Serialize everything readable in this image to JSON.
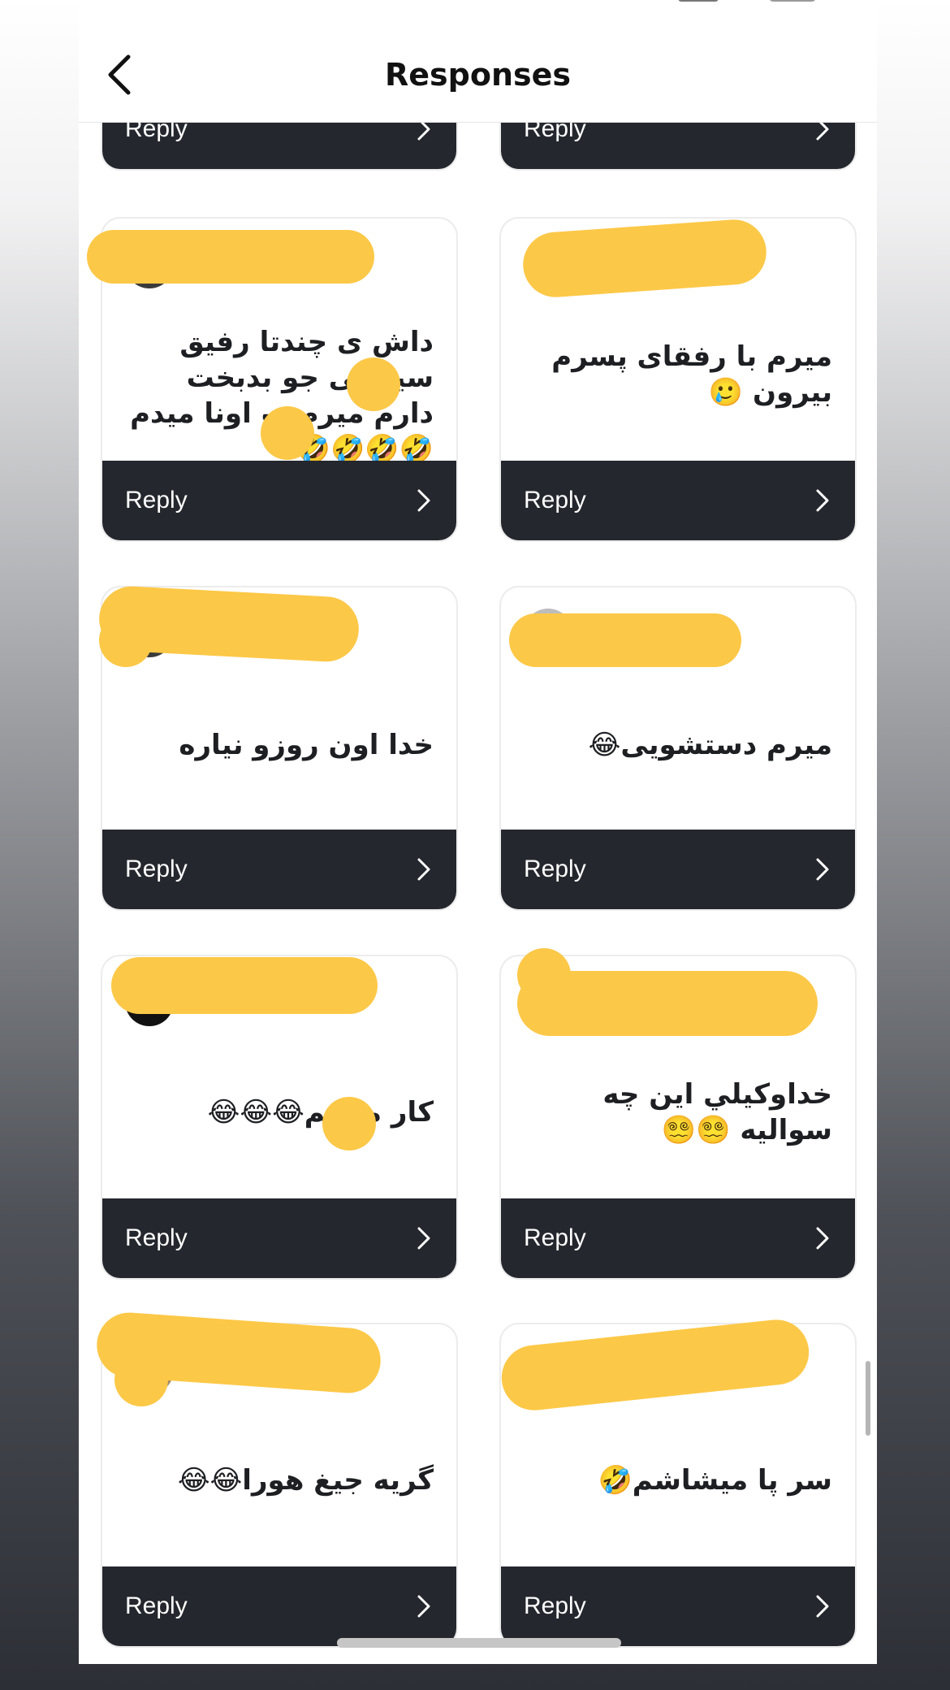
{
  "nav": {
    "title": "Responses"
  },
  "reply_label": "Reply",
  "cards": [
    {
      "text": ""
    },
    {
      "text": ""
    },
    {
      "text": "داش ی چندتا رفیق سینگلی جو بدبخت دارم میرم ب اونا میدم 🤣🤣🤣🤣"
    },
    {
      "text": "میرم با رفقای پسرم بیرون 🥲"
    },
    {
      "text": "خدا اون روزو نیاره"
    },
    {
      "text": "میرم دستشویی😂"
    },
    {
      "text": "کار میکنم😂😂😂"
    },
    {
      "text": "خداوکيلي اين چه سواليه 😵‍💫😵‍💫"
    },
    {
      "text": "گریه جیغ هورا😂😂"
    },
    {
      "text": "سر پا میشاشم🤣"
    }
  ],
  "colors": {
    "redaction": "#fcc847",
    "reply_bar": "#24272d"
  }
}
